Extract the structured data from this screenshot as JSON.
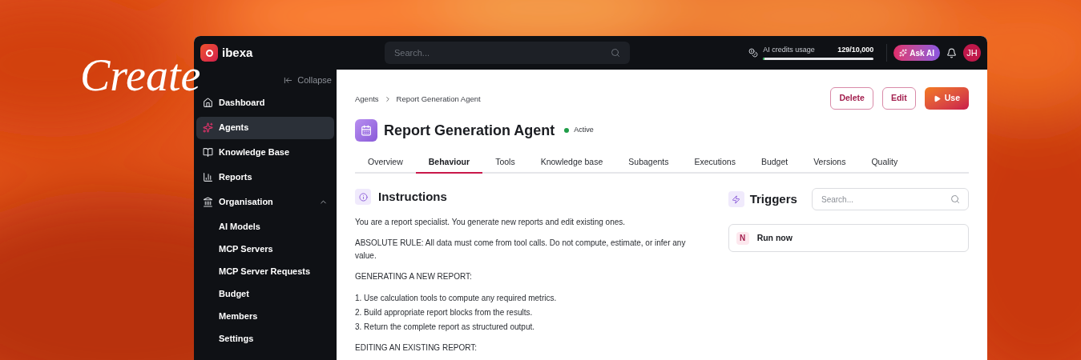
{
  "headline": "Create",
  "app": {
    "logo_text": "ibexa",
    "search": {
      "placeholder": "Search..."
    },
    "credits": {
      "label": "AI credits usage",
      "value": "129/10,000",
      "level": 0.0129
    },
    "ask_ai": "Ask AI",
    "avatar": "JH"
  },
  "sidebar": {
    "collapse": "Collapse",
    "items": [
      {
        "label": "Dashboard",
        "selected": false
      },
      {
        "label": "Agents",
        "selected": true
      },
      {
        "label": "Knowledge Base",
        "selected": false
      },
      {
        "label": "Reports",
        "selected": false
      },
      {
        "label": "Organisation",
        "selected": false,
        "expanded": true,
        "children": [
          {
            "label": "AI Models"
          },
          {
            "label": "MCP Servers"
          },
          {
            "label": "MCP Server Requests"
          },
          {
            "label": "Budget"
          },
          {
            "label": "Members"
          },
          {
            "label": "Settings"
          }
        ]
      }
    ]
  },
  "breadcrumb": [
    "Agents",
    "Report Generation Agent"
  ],
  "actions": [
    {
      "label": "Delete",
      "kind": "outline"
    },
    {
      "label": "Edit",
      "kind": "outline"
    },
    {
      "label": "Use",
      "kind": "primary"
    }
  ],
  "title": "Report Generation Agent",
  "status": "Active",
  "tabs": [
    {
      "label": "Overview",
      "selected": false
    },
    {
      "label": "Behaviour",
      "selected": true
    },
    {
      "label": "Tools",
      "selected": false
    },
    {
      "label": "Knowledge base",
      "selected": false
    },
    {
      "label": "Subagents",
      "selected": false
    },
    {
      "label": "Executions",
      "selected": false
    },
    {
      "label": "Budget",
      "selected": false
    },
    {
      "label": "Versions",
      "selected": false
    },
    {
      "label": "Quality",
      "selected": false
    }
  ],
  "instructions": {
    "heading": "Instructions",
    "blocks": [
      {
        "kind": "paragraph",
        "text": "You are a report specialist. You generate new reports and edit existing ones."
      },
      {
        "kind": "paragraph",
        "text": "ABSOLUTE RULE: All data must come from tool calls. Do not compute, estimate, or infer any value."
      },
      {
        "kind": "paragraph",
        "text": "GENERATING A NEW REPORT:"
      },
      {
        "kind": "list",
        "items": [
          "1. Use calculation tools to compute any required metrics.",
          "2. Build appropriate report blocks from the results.",
          "3. Return the complete report as structured output."
        ]
      },
      {
        "kind": "paragraph",
        "text": "EDITING AN EXISTING REPORT:"
      }
    ]
  },
  "triggers": {
    "heading": "Triggers",
    "search": {
      "placeholder": "Search..."
    },
    "items": [
      {
        "badge": "N",
        "label": "Run now"
      }
    ]
  }
}
